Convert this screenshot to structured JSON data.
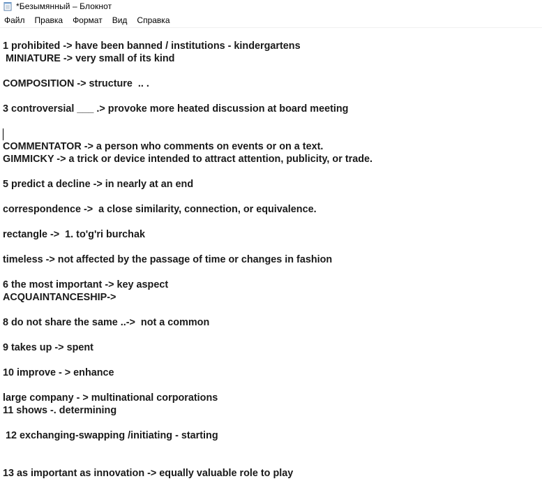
{
  "window": {
    "title": "*Безымянный – Блокнот"
  },
  "icon": {
    "app": "notepad-icon"
  },
  "menu": [
    {
      "label": "Файл"
    },
    {
      "label": "Правка"
    },
    {
      "label": "Формат"
    },
    {
      "label": "Вид"
    },
    {
      "label": "Справка"
    }
  ],
  "editor": {
    "lines": [
      "1 prohibited -> have been banned / institutions - kindergartens",
      " MINIATURE -> very small of its kind",
      "",
      "COMPOSITION -> structure  .. .",
      "",
      "3 controversial ___ .> provoke more heated discussion at board meeting",
      "",
      "",
      "COMMENTATOR -> a person who comments on events or on a text.",
      "GIMMICKY -> a trick or device intended to attract attention, publicity, or trade.",
      "",
      "5 predict a decline -> in nearly at an end",
      "",
      "correspondence ->  a close similarity, connection, or equivalence.",
      "",
      "rectangle ->  1. to'g'ri burchak",
      "",
      "timeless -> not affected by the passage of time or changes in fashion",
      "",
      "6 the most important -> key aspect",
      "ACQUAINTANCESHIP->",
      "",
      "8 do not share the same ..->  not a common",
      "",
      "9 takes up -> spent",
      "",
      "10 improve - > enhance",
      "",
      "large company - > multinational corporations",
      "11 shows -. determining",
      "",
      " 12 exchanging-swapping /initiating - starting",
      "",
      "",
      "13 as important as innovation -> equally valuable role to play"
    ],
    "caret_line": 7
  },
  "colors": {
    "text": "#1a1a1a",
    "background": "#ffffff"
  }
}
